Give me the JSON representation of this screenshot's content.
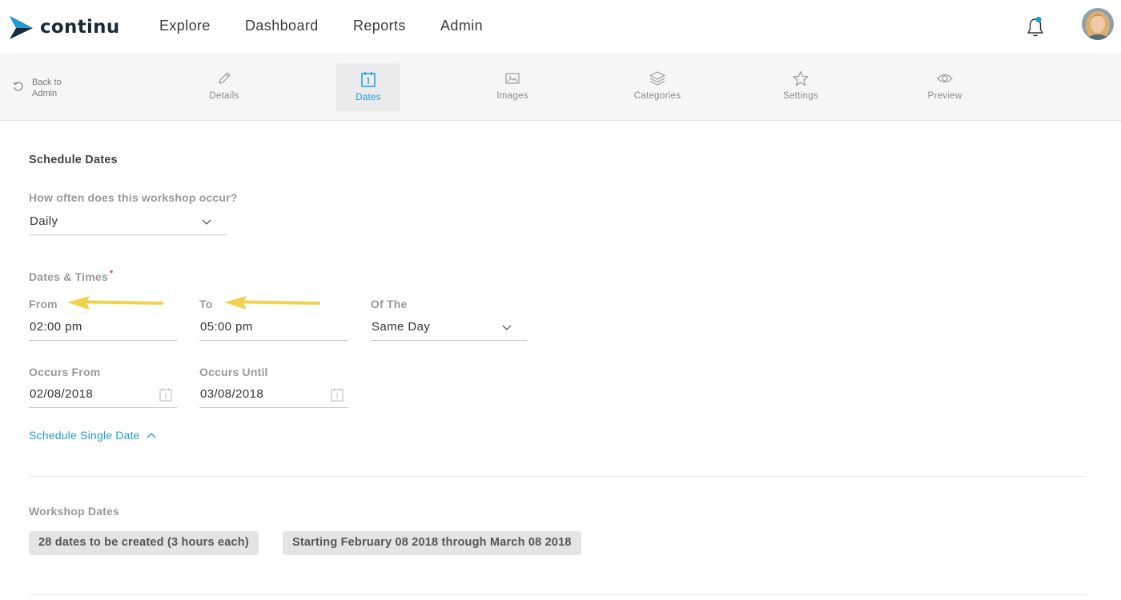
{
  "app": {
    "brand": "continu",
    "colors": {
      "accent": "#1f9bd1",
      "brand_dark": "#1b2a3a",
      "arrow": "#f1d14d",
      "required": "#e0404a"
    }
  },
  "nav": {
    "items": [
      "Explore",
      "Dashboard",
      "Reports",
      "Admin"
    ],
    "bell_icon": "bell-icon",
    "has_notification": true
  },
  "toolbar": {
    "back_label_line1": "Back to",
    "back_label_line2": "Admin",
    "tabs": [
      {
        "label": "Details",
        "icon": "pencil-icon"
      },
      {
        "label": "Dates",
        "icon": "calendar-icon",
        "active": true
      },
      {
        "label": "Images",
        "icon": "image-icon"
      },
      {
        "label": "Categories",
        "icon": "layers-icon"
      },
      {
        "label": "Settings",
        "icon": "star-icon"
      },
      {
        "label": "Preview",
        "icon": "eye-icon"
      }
    ]
  },
  "form": {
    "section_title": "Schedule Dates",
    "frequency": {
      "label": "How often does this workshop occur?",
      "value": "Daily"
    },
    "dates_times_label": "Dates & Times",
    "required_marker": "*",
    "from": {
      "label": "From",
      "value": "02:00 pm"
    },
    "to": {
      "label": "To",
      "value": "05:00 pm"
    },
    "of_the": {
      "label": "Of The",
      "value": "Same Day"
    },
    "occurs_from": {
      "label": "Occurs From",
      "value": "02/08/2018"
    },
    "occurs_until": {
      "label": "Occurs Until",
      "value": "03/08/2018"
    },
    "single_date_link": "Schedule Single Date"
  },
  "workshop": {
    "title": "Workshop Dates",
    "chips": [
      "28 dates to be created (3 hours each)",
      "Starting February 08 2018 through March 08 2018"
    ]
  }
}
